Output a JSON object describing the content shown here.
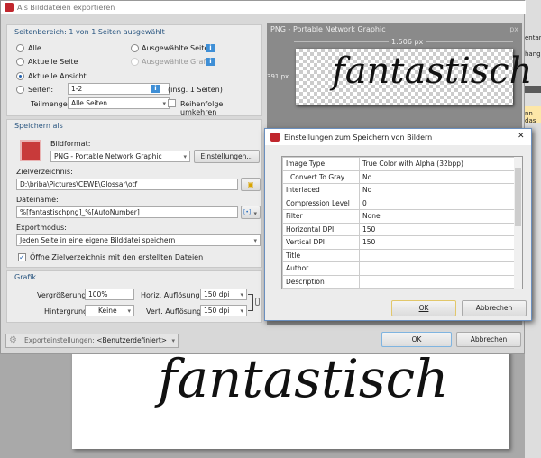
{
  "background": {
    "preview_word": "fantastisch",
    "right_strip": [
      "entar",
      "hang",
      "nn das"
    ]
  },
  "dialog": {
    "title": "Als Bilddateien exportieren",
    "range": {
      "header": "Seitenbereich: 1 von 1 Seiten ausgewählt",
      "all": "Alle",
      "current_page": "Aktuelle Seite",
      "current_view": "Aktuelle Ansicht",
      "pages": "Seiten:",
      "pages_value": "1-2",
      "pages_total": "(insg. 1 Seiten)",
      "selected_pages": "Ausgewählte Seiten",
      "selected_graphic": "Ausgewählte Grafik",
      "subset_label": "Teilmenge:",
      "subset_value": "Alle Seiten",
      "reverse": "Reihenfolge umkehren",
      "info": "i"
    },
    "save": {
      "header": "Speichern als",
      "format_label": "Bildformat:",
      "format_value": "PNG - Portable Network Graphic",
      "settings_button": "Einstellungen...",
      "dir_label": "Zielverzeichnis:",
      "dir_value": "D:\\briba\\Pictures\\CEWE\\Glossar\\otf",
      "filename_label": "Dateiname:",
      "filename_value": "%[fantastischpng]_%[AutoNumber]",
      "macro_button": "[•]",
      "mode_label": "Exportmodus:",
      "mode_value": "Jeden Seite in eine eigene Bilddatei speichern",
      "open_dir": "Öffne Zielverzeichnis mit den erstellten Dateien"
    },
    "graphic": {
      "header": "Grafik",
      "zoom_label": "Vergrößerung:",
      "zoom_value": "100%",
      "bg_label": "Hintergrund:",
      "bg_value": "Keine",
      "hres_label": "Horiz. Auflösung:",
      "hres_value": "150 dpi",
      "vres_label": "Vert. Auflösung:",
      "vres_value": "150 dpi"
    },
    "preview": {
      "title": "PNG - Portable Network Graphic",
      "unit": "px",
      "width": "1.506 px",
      "height": "391 px",
      "word": "fantastisch"
    },
    "footer": {
      "presets_label": "Exporteinstellungen:",
      "presets_value": "<Benutzerdefiniert>",
      "ok": "OK",
      "cancel": "Abbrechen"
    }
  },
  "settings_dialog": {
    "title": "Einstellungen zum Speichern von Bildern",
    "close": "✕",
    "rows": [
      {
        "k": "Image Type",
        "v": "True Color with Alpha (32bpp)"
      },
      {
        "k": "Convert To Gray",
        "v": "No"
      },
      {
        "k": "Interlaced",
        "v": "No"
      },
      {
        "k": "Compression Level",
        "v": "0"
      },
      {
        "k": "Filter",
        "v": "None"
      },
      {
        "k": "Horizontal DPI",
        "v": "150"
      },
      {
        "k": "Vertical DPI",
        "v": "150"
      },
      {
        "k": "Title",
        "v": ""
      },
      {
        "k": "Author",
        "v": ""
      },
      {
        "k": "Description",
        "v": ""
      }
    ],
    "ok": "OK",
    "cancel": "Abbrechen"
  }
}
